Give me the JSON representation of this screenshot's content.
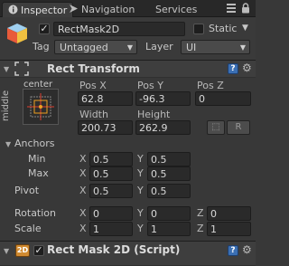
{
  "tabs": [
    {
      "label": "Inspector",
      "active": true
    },
    {
      "label": "Navigation",
      "active": false
    },
    {
      "label": "Services",
      "active": false
    }
  ],
  "gameobject": {
    "active": true,
    "name": "RectMask2D",
    "static_label": "Static",
    "static_checked": false,
    "tag_label": "Tag",
    "tag_value": "Untagged",
    "layer_label": "Layer",
    "layer_value": "UI"
  },
  "rect_transform": {
    "title": "Rect Transform",
    "anchor_preset_top": "center",
    "anchor_preset_side": "middle",
    "pos_x_label": "Pos X",
    "pos_y_label": "Pos Y",
    "pos_z_label": "Pos Z",
    "pos_x": "62.8",
    "pos_y": "-96.3",
    "pos_z": "0",
    "width_label": "Width",
    "height_label": "Height",
    "width": "200.73",
    "height": "262.9",
    "r_button": "R",
    "anchors_label": "Anchors",
    "min_label": "Min",
    "max_label": "Max",
    "anchor_min_x": "0.5",
    "anchor_min_y": "0.5",
    "anchor_max_x": "0.5",
    "anchor_max_y": "0.5",
    "pivot_label": "Pivot",
    "pivot_x": "0.5",
    "pivot_y": "0.5",
    "rotation_label": "Rotation",
    "rotation_x": "0",
    "rotation_y": "0",
    "rotation_z": "0",
    "scale_label": "Scale",
    "scale_x": "1",
    "scale_y": "1",
    "scale_z": "1",
    "axis_x": "X",
    "axis_y": "Y",
    "axis_z": "Z"
  },
  "rect_mask": {
    "title": "Rect Mask 2D (Script)",
    "enabled": true,
    "icon_text": "2D"
  },
  "colors": {
    "background": "#383838",
    "help_blue": "#3b6fb3",
    "anchor_red": "#e04030",
    "anchor_orange": "#f0a020"
  }
}
